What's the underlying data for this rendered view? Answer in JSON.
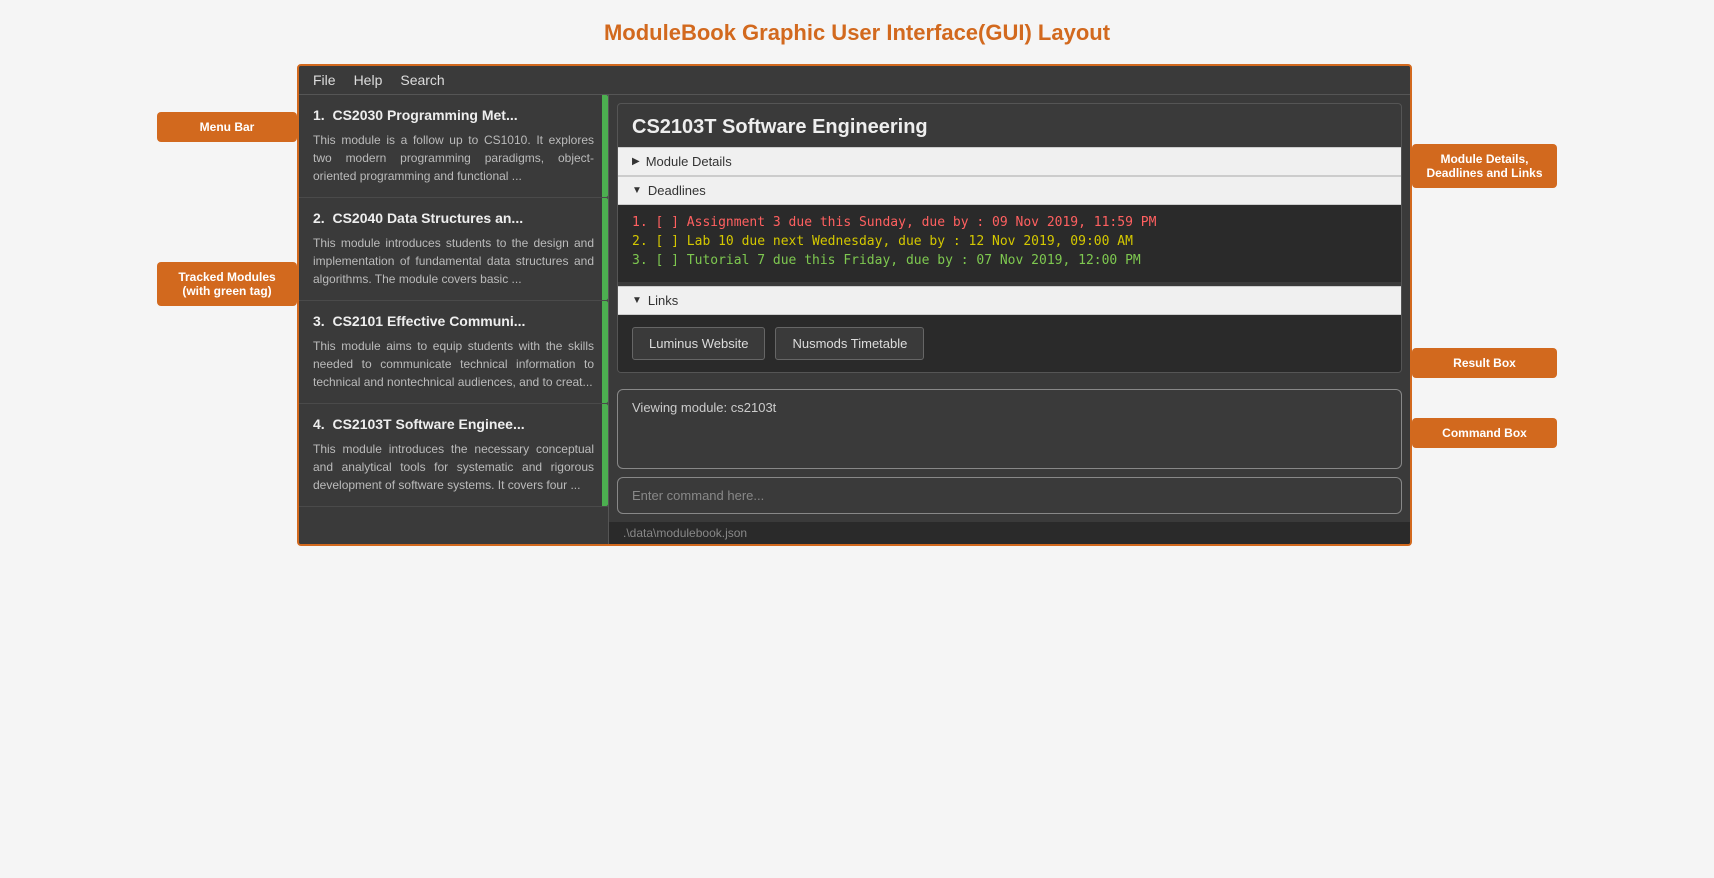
{
  "page": {
    "title": "ModuleBook Graphic User Interface(GUI) Layout"
  },
  "annotations": {
    "left": [
      {
        "id": "menu-bar-label",
        "text": "Menu Bar",
        "top_offset": "10px"
      },
      {
        "id": "tracked-modules-label",
        "text": "Tracked Modules (with green tag)",
        "top_offset": "120px"
      }
    ],
    "right": [
      {
        "id": "module-details-label",
        "text": "Module Details, Deadlines and Links",
        "top_offset": "60px"
      },
      {
        "id": "result-box-label",
        "text": "Result Box",
        "top_offset": "300px"
      },
      {
        "id": "command-box-label",
        "text": "Command Box",
        "top_offset": "400px"
      }
    ]
  },
  "menu_bar": {
    "items": [
      "File",
      "Help",
      "Search"
    ]
  },
  "modules": [
    {
      "number": "1",
      "title": "CS2030 Programming Met...",
      "description": "This module is a follow up to CS1010. It explores two modern programming paradigms, object-oriented programming and functional ...",
      "has_green_tag": true
    },
    {
      "number": "2",
      "title": "CS2040 Data Structures an...",
      "description": "This module introduces students to the design and implementation of fundamental data structures and algorithms. The module covers basic ...",
      "has_green_tag": true
    },
    {
      "number": "3",
      "title": "CS2101 Effective Communi...",
      "description": "This module aims to equip students with the skills needed to communicate technical information to technical and nontechnical audiences, and to creat...",
      "has_green_tag": true
    },
    {
      "number": "4",
      "title": "CS2103T Software Enginee...",
      "description": "This module introduces the necessary conceptual and analytical tools for systematic and rigorous development of software systems. It covers four ...",
      "has_green_tag": true
    }
  ],
  "module_detail": {
    "title": "CS2103T Software Engineering",
    "sections": {
      "module_details": {
        "label": "Module Details",
        "collapsed": true,
        "arrow": "▶"
      },
      "deadlines": {
        "label": "Deadlines",
        "collapsed": false,
        "arrow": "▼",
        "items": [
          {
            "number": "1",
            "text": "[ ]  Assignment 3 due this Sunday, due by : 09 Nov 2019, 11:59 PM",
            "color_class": "deadline-red"
          },
          {
            "number": "2",
            "text": "[ ]  Lab 10 due next Wednesday, due by : 12 Nov 2019, 09:00 AM",
            "color_class": "deadline-yellow"
          },
          {
            "number": "3",
            "text": "[ ]  Tutorial 7 due this Friday, due by : 07 Nov 2019, 12:00 PM",
            "color_class": "deadline-green"
          }
        ]
      },
      "links": {
        "label": "Links",
        "collapsed": false,
        "arrow": "▼",
        "buttons": [
          {
            "label": "Luminus Website"
          },
          {
            "label": "Nusmods Timetable"
          }
        ]
      }
    }
  },
  "result_box": {
    "text": "Viewing module: cs2103t"
  },
  "command_box": {
    "placeholder": "Enter command here..."
  },
  "status_bar": {
    "text": ".\\data\\modulebook.json"
  }
}
